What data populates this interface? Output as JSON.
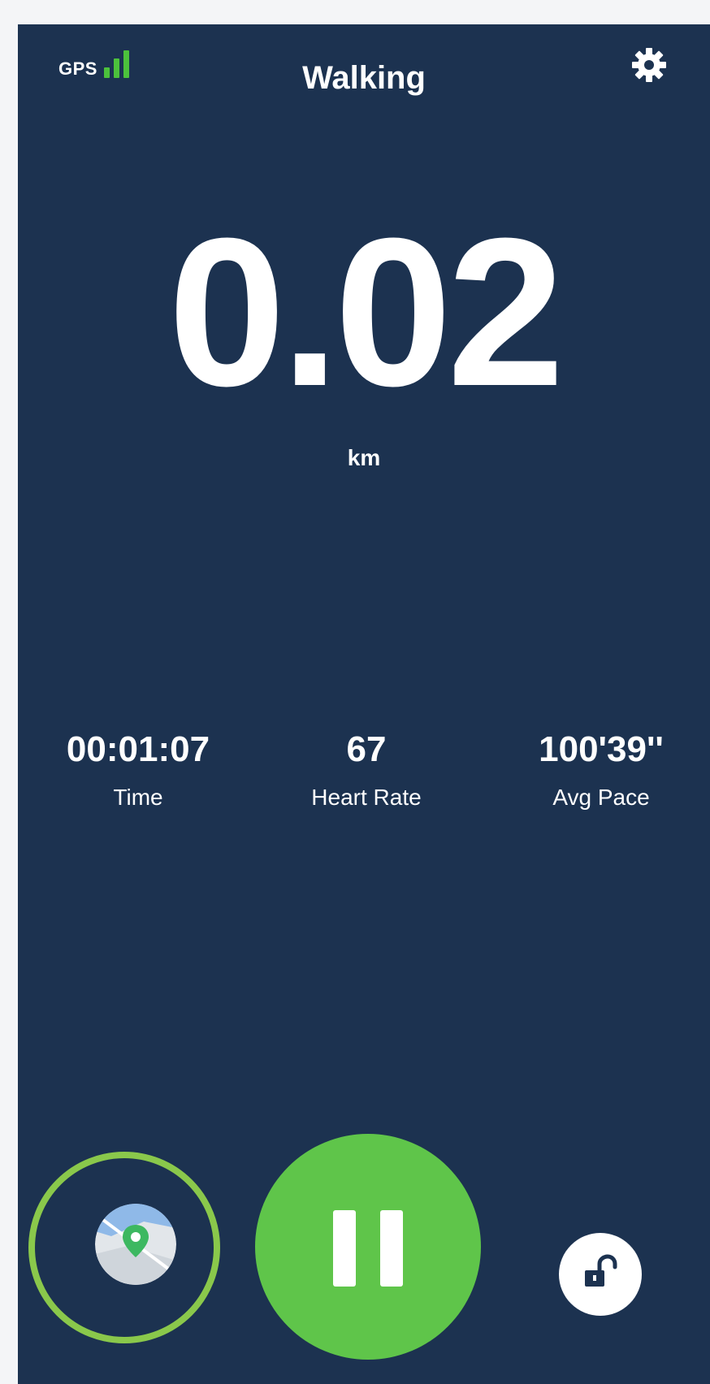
{
  "header": {
    "gps_label": "GPS",
    "gps_signal_bars": 3,
    "title": "Walking",
    "settings_icon": "gear-icon"
  },
  "distance": {
    "value": "0.02",
    "unit": "km"
  },
  "stats": [
    {
      "value": "00:01:07",
      "label": "Time"
    },
    {
      "value": "67",
      "label": "Heart Rate"
    },
    {
      "value": "100'39''",
      "label": "Avg Pace"
    }
  ],
  "controls": {
    "map_icon": "map-pin-icon",
    "pause_icon": "pause-icon",
    "lock_icon": "unlock-icon"
  },
  "colors": {
    "background": "#1c3250",
    "accent_green": "#5fc54a",
    "ring_green": "#8ac84b",
    "gps_green": "#4cc13c",
    "text": "#ffffff"
  }
}
